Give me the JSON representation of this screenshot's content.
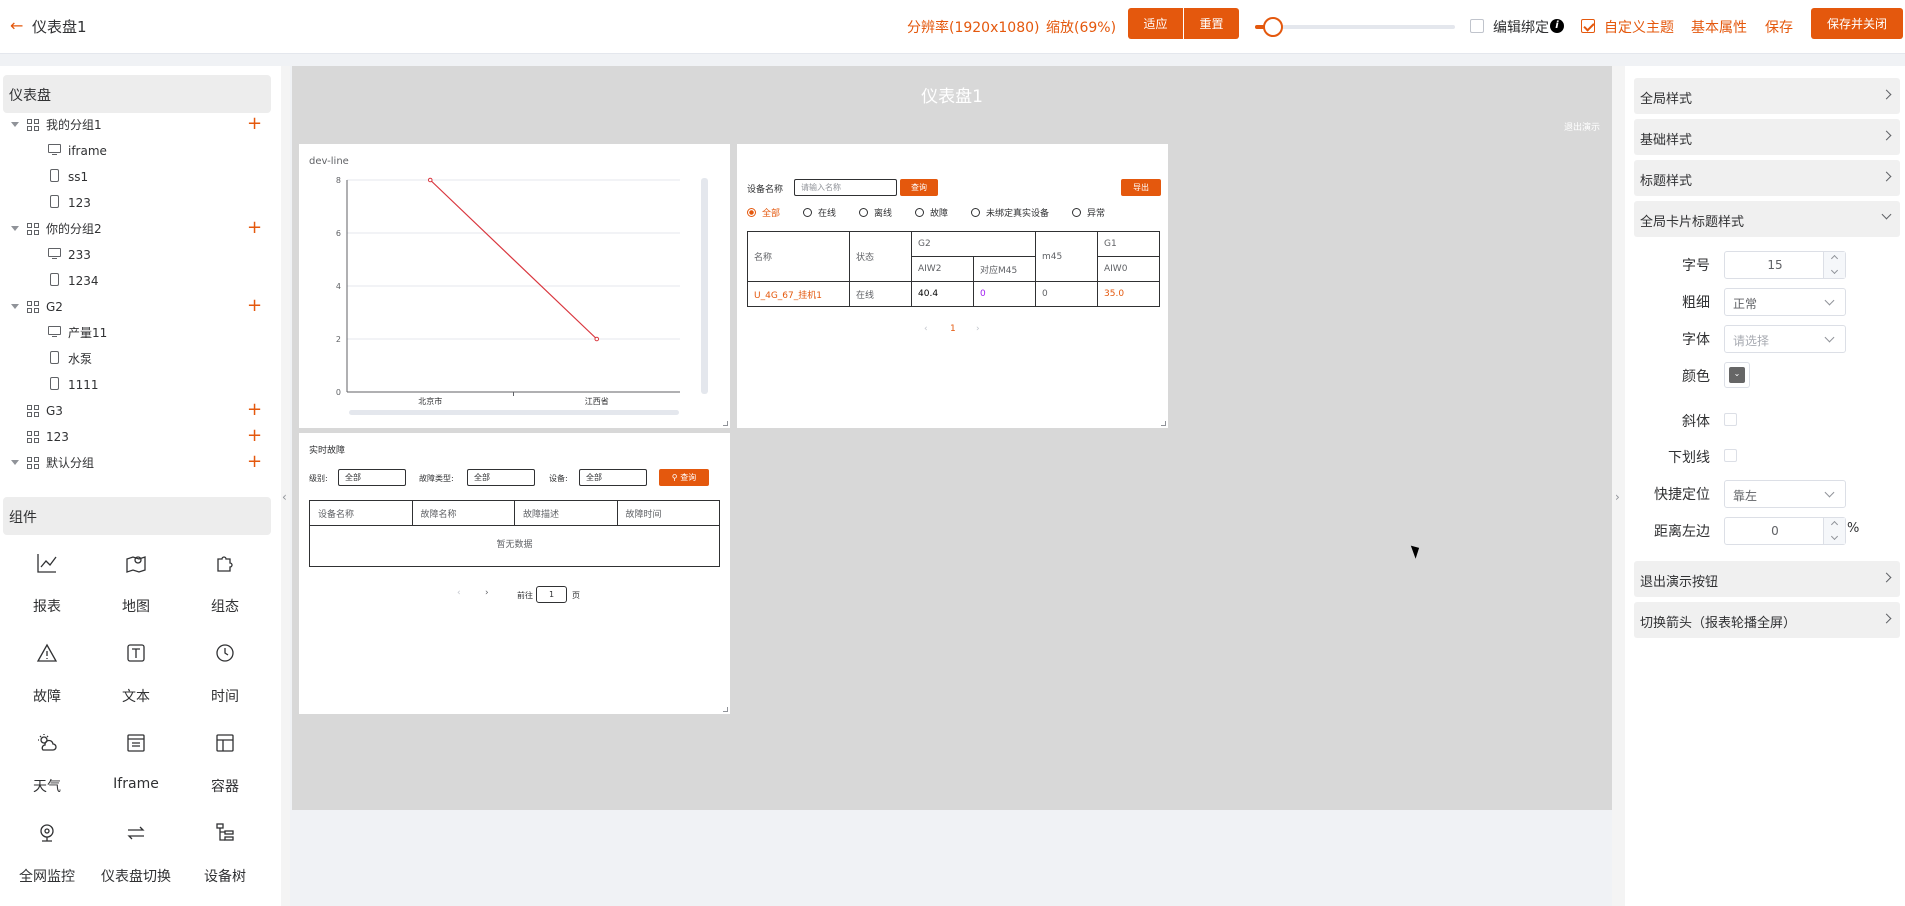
{
  "topbar": {
    "title": "仪表盘1",
    "resolution": "分辨率(1920x1080)",
    "zoom": "缩放(69%)",
    "fit_label": "适应",
    "reset_label": "重置",
    "zoom_level": 0.69,
    "edit_bind_label": "编辑绑定",
    "edit_bind_checked": false,
    "custom_theme_label": "自定义主题",
    "custom_theme_checked": true,
    "basic_props_label": "基本属性",
    "save_label": "保存",
    "save_close_label": "保存并关闭"
  },
  "sidebar": {
    "dashboard_header": "仪表盘",
    "tree": [
      {
        "label": "我的分组1",
        "type": "group",
        "expanded": true
      },
      {
        "label": "iframe",
        "type": "monitor"
      },
      {
        "label": "ss1",
        "type": "phone"
      },
      {
        "label": "123",
        "type": "phone"
      },
      {
        "label": "你的分组2",
        "type": "group",
        "expanded": true
      },
      {
        "label": "233",
        "type": "monitor"
      },
      {
        "label": "1234",
        "type": "phone"
      },
      {
        "label": "G2",
        "type": "group",
        "expanded": true
      },
      {
        "label": "产量11",
        "type": "monitor"
      },
      {
        "label": "水泵",
        "type": "phone"
      },
      {
        "label": "1111",
        "type": "phone"
      },
      {
        "label": "G3",
        "type": "group",
        "expanded": false
      },
      {
        "label": "123",
        "type": "group",
        "expanded": false
      },
      {
        "label": "默认分组",
        "type": "group",
        "expanded": true
      }
    ],
    "components_header": "组件",
    "components": [
      {
        "label": "报表",
        "icon": "line-chart-icon"
      },
      {
        "label": "地图",
        "icon": "map-icon"
      },
      {
        "label": "组态",
        "icon": "puzzle-icon"
      },
      {
        "label": "故障",
        "icon": "warning-icon"
      },
      {
        "label": "文本",
        "icon": "text-icon"
      },
      {
        "label": "时间",
        "icon": "clock-icon"
      },
      {
        "label": "天气",
        "icon": "weather-icon"
      },
      {
        "label": "Iframe",
        "icon": "iframe-icon"
      },
      {
        "label": "容器",
        "icon": "layout-icon"
      },
      {
        "label": "全网监控",
        "icon": "camera-icon"
      },
      {
        "label": "仪表盘切换",
        "icon": "switch-icon"
      },
      {
        "label": "设备树",
        "icon": "tree-icon"
      }
    ]
  },
  "canvas": {
    "title": "仪表盘1",
    "exit_demo": "退出演示",
    "line_card": {
      "title": "dev-line"
    },
    "device_card": {
      "name_label": "设备名称",
      "name_placeholder": "请输入名称",
      "query_label": "查询",
      "export_label": "导出",
      "radios": [
        "全部",
        "在线",
        "离线",
        "故障",
        "未绑定真实设备",
        "异常"
      ],
      "head": {
        "name": "名称",
        "status": "状态",
        "g2": "G2",
        "m45": "m45",
        "g1": "G1",
        "aiw2": "AIW2",
        "dui": "对应M45",
        "aiw0": "AIW0"
      },
      "row": {
        "name": "U_4G_67_挂机1",
        "status": "在线",
        "aiw2": "40.4",
        "dui": "0",
        "m45": "0",
        "aiw0": "35.0"
      },
      "page": "1"
    },
    "fault_card": {
      "title": "实时故障",
      "level_label": "级别:",
      "level_value": "全部",
      "type_label": "故障类型:",
      "type_value": "全部",
      "device_label": "设备:",
      "device_value": "全部",
      "query_label": "查询",
      "cols": [
        "设备名称",
        "故障名称",
        "故障描述",
        "故障时间"
      ],
      "empty": "暂无数据",
      "goto_label": "前往",
      "goto_page": "1",
      "page_unit": "页"
    }
  },
  "chart_data": {
    "type": "line",
    "categories": [
      "北京市",
      "江西省"
    ],
    "series": [
      {
        "values": [
          8,
          2
        ]
      }
    ],
    "ylim": [
      0,
      8
    ],
    "yticks": [
      "0",
      "2",
      "4",
      "6",
      "8"
    ],
    "grid": true,
    "color": "#d9363e"
  },
  "right_panel": {
    "sections": [
      "全局样式",
      "基础样式",
      "标题样式",
      "全局卡片标题样式"
    ],
    "form": {
      "font_size_label": "字号",
      "font_size": "15",
      "weight_label": "粗细",
      "weight": "正常",
      "font_label": "字体",
      "font_placeholder": "请选择",
      "color_label": "颜色",
      "italic_label": "斜体",
      "underline_label": "下划线",
      "position_label": "快捷定位",
      "position": "靠左",
      "left_distance_label": "距离左边",
      "left_distance": "0",
      "unit": "%"
    },
    "sections_after": [
      "退出演示按钮",
      "切换箭头（报表轮播全屏）"
    ]
  }
}
